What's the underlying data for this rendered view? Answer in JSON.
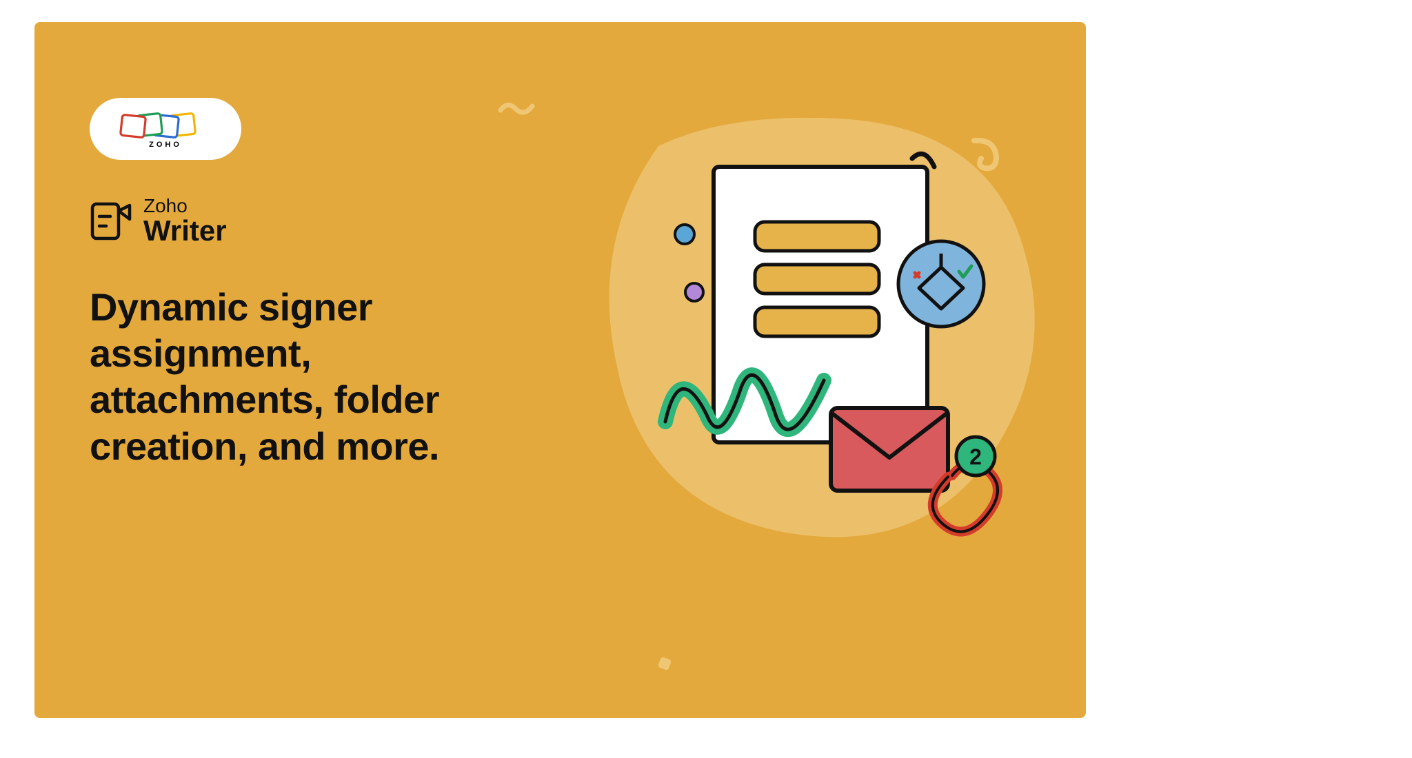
{
  "brand": {
    "company": "ZOHO",
    "product_eyebrow": "Zoho",
    "product_name": "Writer"
  },
  "headline": "Dynamic signer assignment, attachments, folder creation, and more.",
  "attachment_badge": "2",
  "colors": {
    "background": "#e4a93d",
    "text": "#111111",
    "accent_green": "#2fb67c",
    "accent_red": "#d85a5c",
    "accent_blue": "#7fb5dd"
  }
}
